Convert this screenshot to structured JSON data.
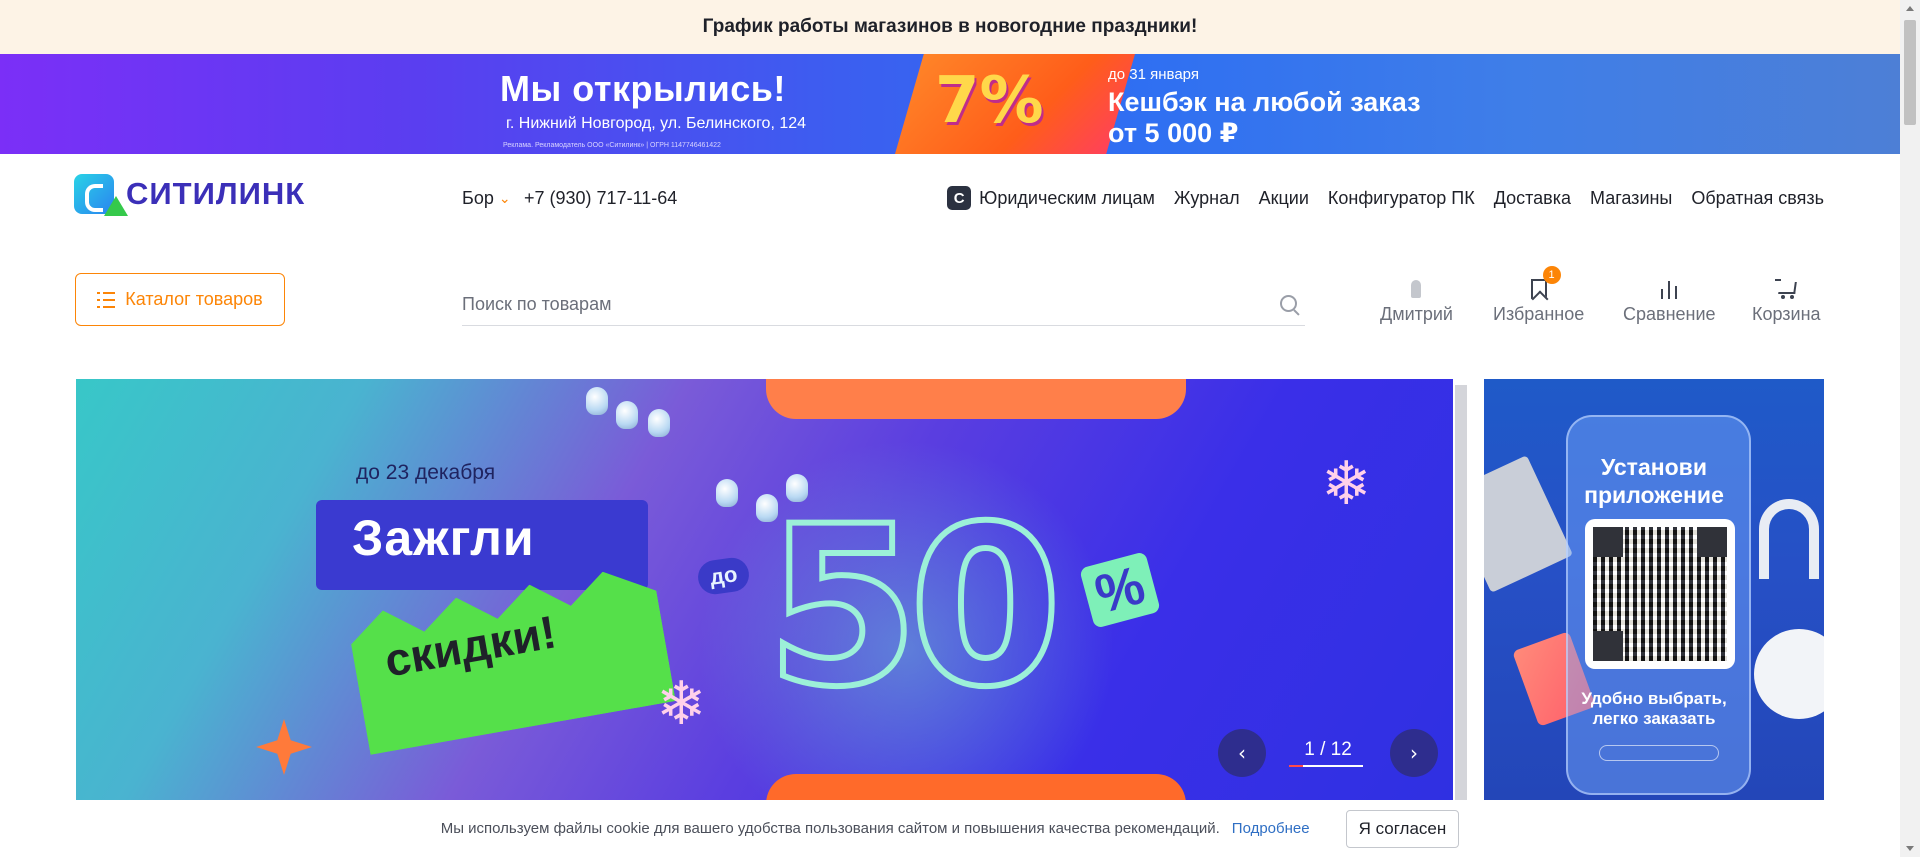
{
  "notice": {
    "text": "График работы магазинов в новогодние праздники!"
  },
  "promo_banner": {
    "title": "Мы открылись!",
    "address": "г. Нижний Новгород, ул. Белинского, 124",
    "legal": "Реклама. Рекламодатель ООО «Ситилинк» | ОГРН 1147746461422",
    "percent": "7%",
    "until": "до 31 января",
    "cashback_line1": "Кешбэк на любой заказ",
    "cashback_line2": "от 5 000 ₽"
  },
  "header": {
    "logo_text": "СИТИЛИНК",
    "city": "Бор",
    "phone": "+7 (930) 717-11-64",
    "nav": {
      "legal": "Юридическим лицам",
      "journal": "Журнал",
      "promos": "Акции",
      "pc_config": "Конфигуратор ПК",
      "delivery": "Доставка",
      "stores": "Магазины",
      "feedback": "Обратная связь"
    }
  },
  "catalog": {
    "label": "Каталог товаров"
  },
  "search": {
    "placeholder": "Поиск по товарам",
    "value": ""
  },
  "actions": {
    "user": "Дмитрий",
    "favorites": "Избранное",
    "favorites_count": "1",
    "compare": "Сравнение",
    "cart": "Корзина"
  },
  "hero": {
    "until": "до 23 декабря",
    "headline1": "Зажгли",
    "headline2": "скидки!",
    "upto": "до",
    "discount": "50",
    "percent": "%",
    "counter": "1 / 12",
    "current_slide": 1,
    "total_slides": 12,
    "prev_icon": "chevron-left-icon",
    "next_icon": "chevron-right-icon"
  },
  "app_promo": {
    "title_line1": "Установи",
    "title_line2": "приложение",
    "subtitle_line1": "Удобно выбрать,",
    "subtitle_line2": "легко заказать"
  },
  "cookie": {
    "text": "Мы используем файлы cookie для вашего удобства пользования сайтом и повышения качества рекомендаций.",
    "link": "Подробнее",
    "accept": "Я согласен"
  },
  "colors": {
    "accent": "#fc8507",
    "brand": "#3b2fb8",
    "notice_bg": "#fdf3e6",
    "link": "#2f6fc4"
  }
}
